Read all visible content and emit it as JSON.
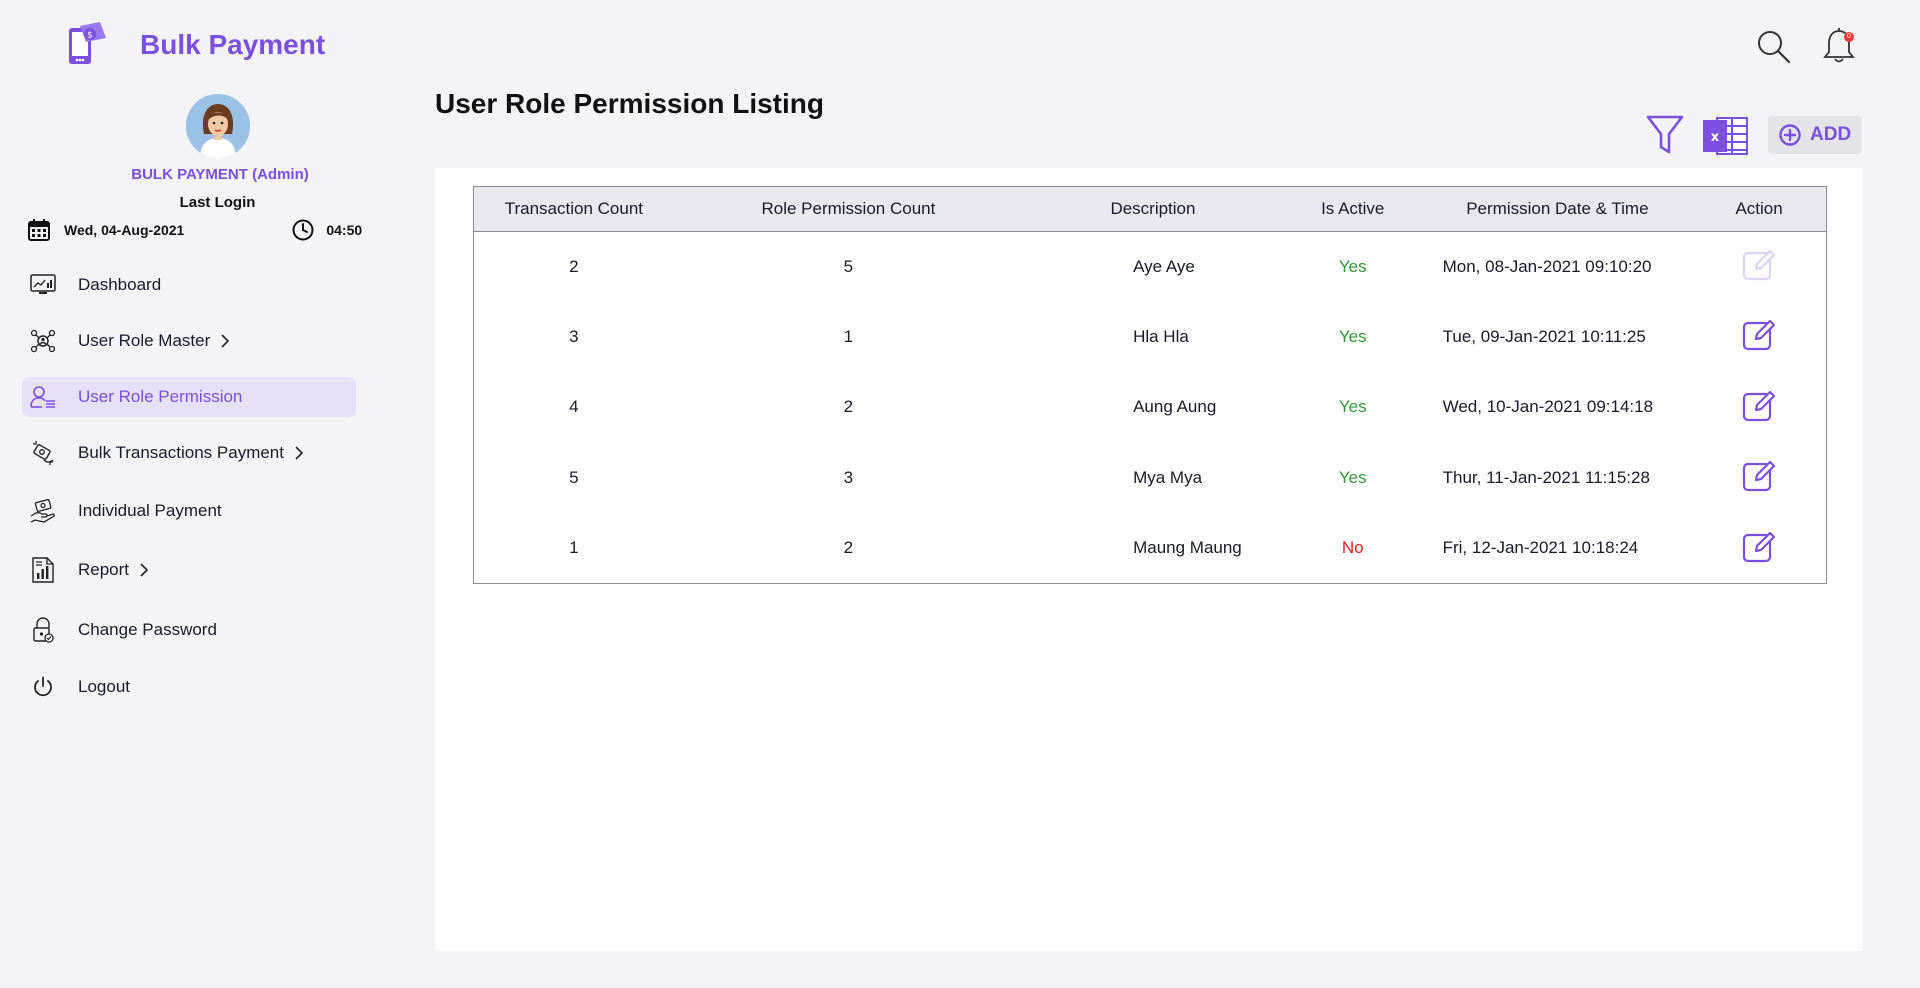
{
  "app": {
    "title": "Bulk Payment"
  },
  "user": {
    "name": "BULK PAYMENT (Admin)",
    "last_login_label": "Last Login",
    "last_login_date": "Wed, 04-Aug-2021",
    "last_login_time": "04:50"
  },
  "sidebar": {
    "items": [
      {
        "label": "Dashboard",
        "icon": "dashboard-icon",
        "has_submenu": false,
        "active": false
      },
      {
        "label": "User Role Master",
        "icon": "user-role-master-icon",
        "has_submenu": true,
        "active": false
      },
      {
        "label": "User Role Permission",
        "icon": "user-permission-icon",
        "has_submenu": false,
        "active": true
      },
      {
        "label": "Bulk Transactions Payment",
        "icon": "bulk-transactions-icon",
        "has_submenu": true,
        "active": false
      },
      {
        "label": "Individual Payment",
        "icon": "individual-payment-icon",
        "has_submenu": false,
        "active": false
      },
      {
        "label": "Report",
        "icon": "report-icon",
        "has_submenu": true,
        "active": false
      },
      {
        "label": "Change Password",
        "icon": "change-password-icon",
        "has_submenu": false,
        "active": false
      },
      {
        "label": "Logout",
        "icon": "power-icon",
        "has_submenu": false,
        "active": false
      }
    ]
  },
  "header": {
    "notification_count": "0"
  },
  "main": {
    "title": "User Role Permission Listing",
    "add_label": "ADD",
    "table": {
      "columns": [
        "Transaction Count",
        "Role Permission Count",
        "Description",
        "Is Active",
        "Permission Date & Time",
        "Action"
      ],
      "rows": [
        {
          "transaction_count": "2",
          "role_permission_count": "5",
          "description": "Aye Aye",
          "is_active": "Yes",
          "date_time": "Mon, 08-Jan-2021  09:10:20",
          "edit_enabled": false
        },
        {
          "transaction_count": "3",
          "role_permission_count": "1",
          "description": "Hla Hla",
          "is_active": "Yes",
          "date_time": "Tue, 09-Jan-2021  10:11:25",
          "edit_enabled": true
        },
        {
          "transaction_count": "4",
          "role_permission_count": "2",
          "description": "Aung Aung",
          "is_active": "Yes",
          "date_time": "Wed, 10-Jan-2021 09:14:18",
          "edit_enabled": true
        },
        {
          "transaction_count": "5",
          "role_permission_count": "3",
          "description": "Mya Mya",
          "is_active": "Yes",
          "date_time": "Thur, 11-Jan-2021 11:15:28",
          "edit_enabled": true
        },
        {
          "transaction_count": "1",
          "role_permission_count": "2",
          "description": "Maung Maung",
          "is_active": "No",
          "date_time": "Fri, 12-Jan-2021  10:18:24",
          "edit_enabled": true
        }
      ]
    }
  },
  "colors": {
    "accent": "#7b4fe0",
    "active_yes": "#2e9a35",
    "active_no": "#e02020",
    "background": "#f4f4f7"
  }
}
